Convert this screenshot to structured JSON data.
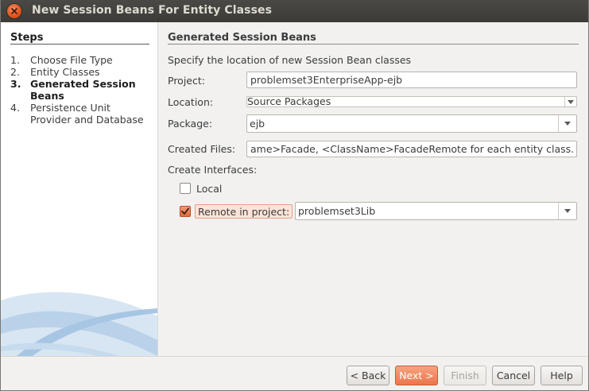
{
  "window": {
    "title": "New Session Beans For Entity Classes"
  },
  "steps": {
    "heading": "Steps",
    "items": [
      {
        "num": "1.",
        "label": "Choose File Type"
      },
      {
        "num": "2.",
        "label": "Entity Classes"
      },
      {
        "num": "3.",
        "label": "Generated Session Beans"
      },
      {
        "num": "4.",
        "label": "Persistence Unit Provider and Database"
      }
    ],
    "current_index": 2
  },
  "panel": {
    "title": "Generated Session Beans",
    "description": "Specify the location of new Session Bean classes",
    "project_label": "Project:",
    "project_value": "problemset3EnterpriseApp-ejb",
    "location_label": "Location:",
    "location_value": "Source Packages",
    "package_label": "Package:",
    "package_value": "ejb",
    "created_files_label": "Created Files:",
    "created_files_value": "ame>Facade, <ClassName>FacadeRemote for each entity class.",
    "interfaces_label": "Create Interfaces:",
    "local_label": "Local",
    "local_checked": false,
    "remote_label": "Remote in project:",
    "remote_checked": true,
    "remote_project_value": "problemset3Lib"
  },
  "buttons": {
    "back": "< Back",
    "next": "Next >",
    "finish": "Finish",
    "cancel": "Cancel",
    "help": "Help"
  },
  "colors": {
    "accent": "#e9774d",
    "titlebar": "#3c3b37",
    "sidebar_art": "#bfd6ec"
  }
}
